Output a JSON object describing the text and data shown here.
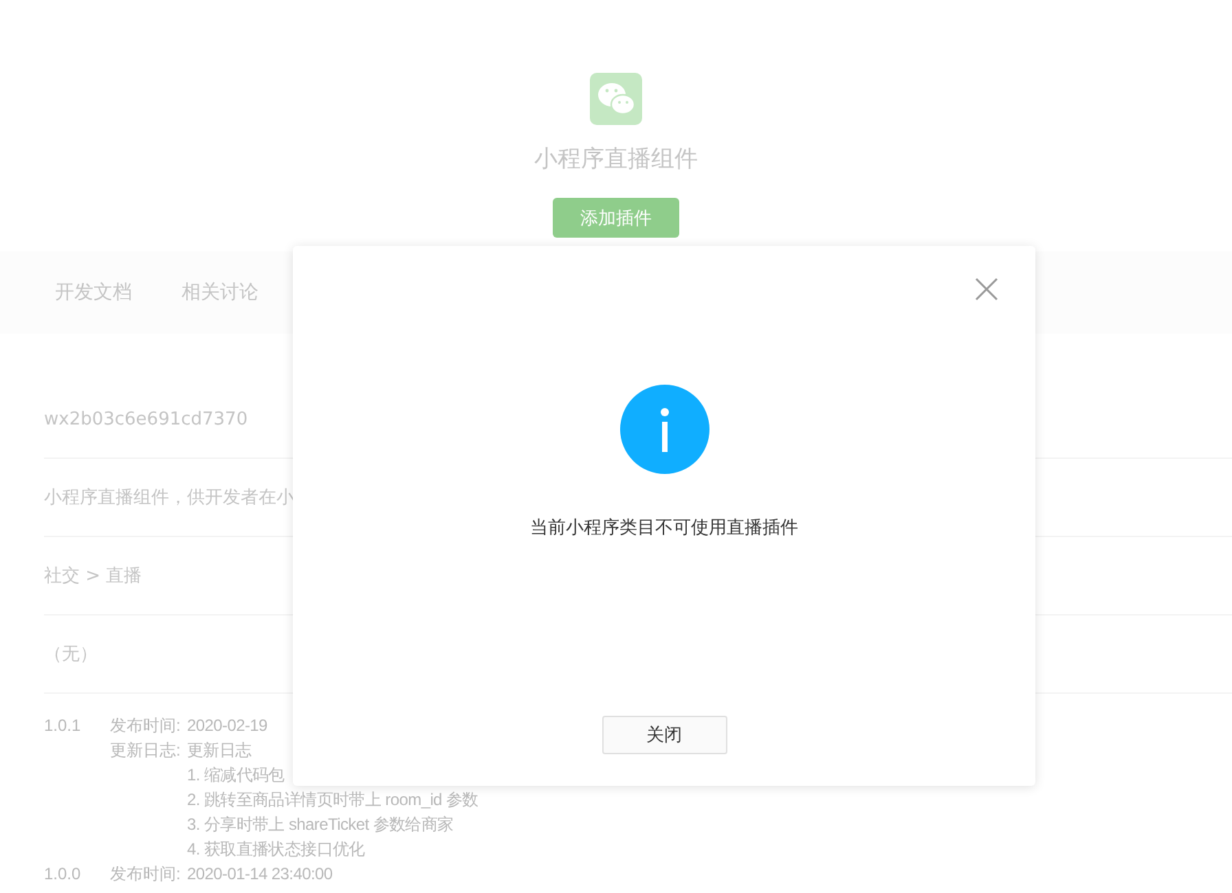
{
  "header": {
    "title": "小程序直播组件",
    "add_button": "添加插件"
  },
  "tabs": [
    {
      "label": "开发文档",
      "selected": false
    },
    {
      "label": "相关讨论",
      "selected": false
    }
  ],
  "info_rows": [
    "wx2b03c6e691cd7370",
    "小程序直播组件，供开发者在小",
    "社交 > 直播",
    "（无）"
  ],
  "versions": [
    {
      "version": "1.0.1",
      "fields": [
        {
          "label": "发布时间:",
          "lines": [
            "2020-02-19"
          ]
        },
        {
          "label": "更新日志:",
          "lines": [
            "更新日志",
            "1. 缩减代码包",
            "2. 跳转至商品详情页时带上 room_id 参数",
            "3. 分享时带上 shareTicket 参数给商家",
            "4. 获取直播状态接口优化"
          ]
        }
      ]
    },
    {
      "version": "1.0.0",
      "fields": [
        {
          "label": "发布时间:",
          "lines": [
            "2020-01-14 23:40:00"
          ]
        }
      ]
    }
  ],
  "dialog": {
    "message": "当前小程序类目不可使用直播插件",
    "close_button": "关闭"
  }
}
